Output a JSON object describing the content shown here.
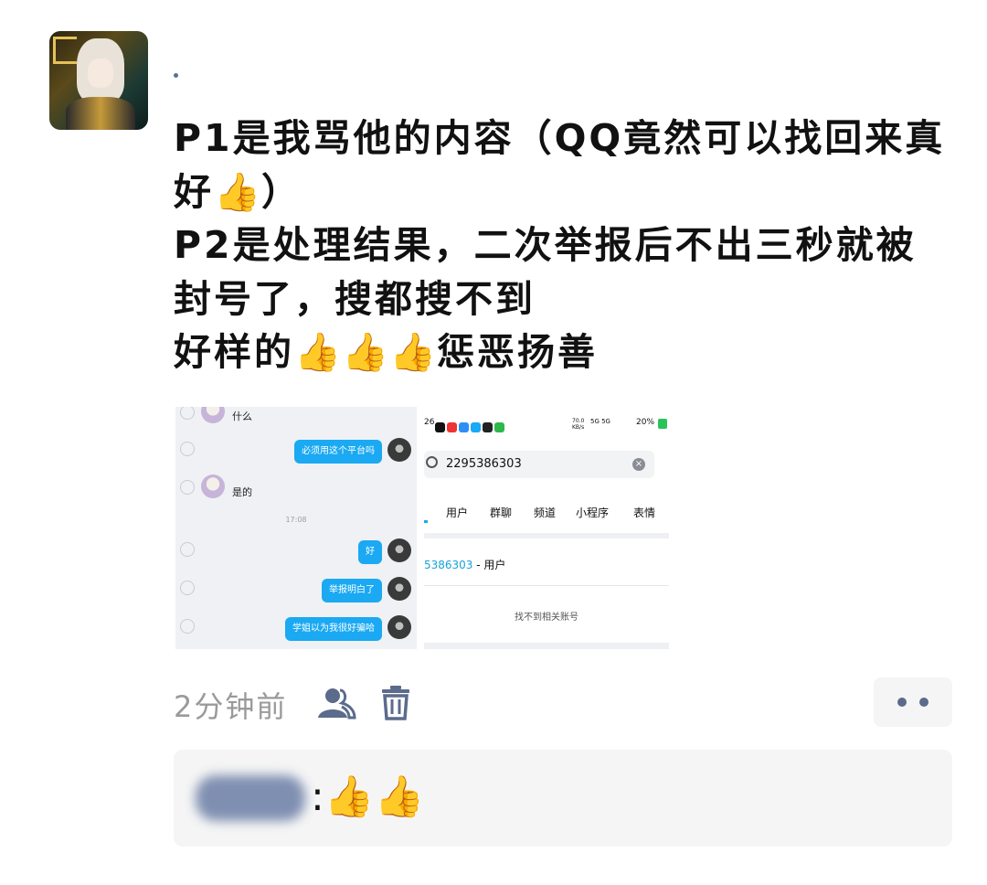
{
  "post": {
    "lines": [
      "P1是我骂他的内容（QQ竟然可以找回来真",
      "好",
      "）",
      "P2是处理结果，二次举报后不出三秒就被",
      "封号了，搜都搜不到",
      "好样的",
      "惩恶扬善"
    ],
    "thumb_emoji": "👍"
  },
  "screenshot_chat": {
    "msg_what": "什么",
    "msg_must_use": "必须用这个平台吗",
    "msg_yes": "是的",
    "timestamp": "17:08",
    "msg_ok": "好",
    "msg_report_understood": "举报明白了",
    "msg_thought": "学姐以为我很好骗哈"
  },
  "screenshot_search": {
    "status_time": "26",
    "status_net": "70.0 KB/s",
    "status_signal": "5G 5G",
    "status_battery": "20%",
    "search_value": "2295386303",
    "clear_icon": "close-circle-icon",
    "tabs": [
      "用户",
      "群聊",
      "频道",
      "小程序",
      "表情"
    ],
    "result_number": "5386303",
    "result_suffix": "- 用户",
    "empty_text": "找不到相关账号"
  },
  "footer": {
    "time_ago": "2分钟前"
  },
  "comment": {
    "text": ":👍👍"
  },
  "colors": {
    "accent_blue": "#1aa9f2",
    "icon_slate": "#5b6b8c",
    "time_gray": "#9a9a9a"
  }
}
